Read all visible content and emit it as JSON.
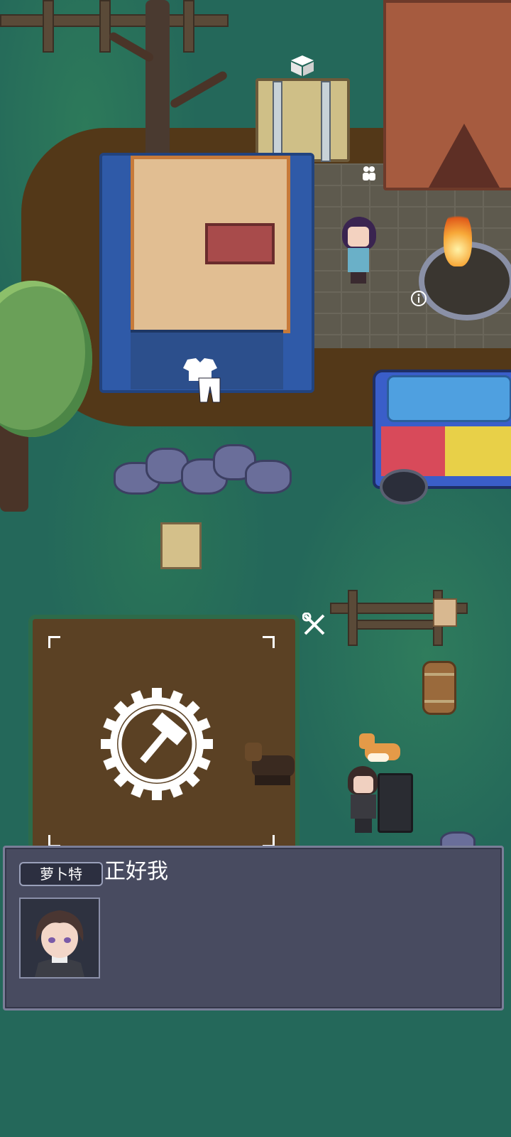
{
  "dialog": {
    "speaker": "萝卜特",
    "text": "正好我"
  },
  "icons": {
    "box": "box-icon",
    "people": "people-icon",
    "info": "info-icon",
    "clothing": "clothing-icon",
    "tools": "wrench-screwdriver-icon",
    "build": "hammer-gear-icon"
  },
  "colors": {
    "dialog_bg": "#484b60",
    "dialog_border": "#7a7e98",
    "grass": "#24685a",
    "water": "#1d5a57"
  }
}
